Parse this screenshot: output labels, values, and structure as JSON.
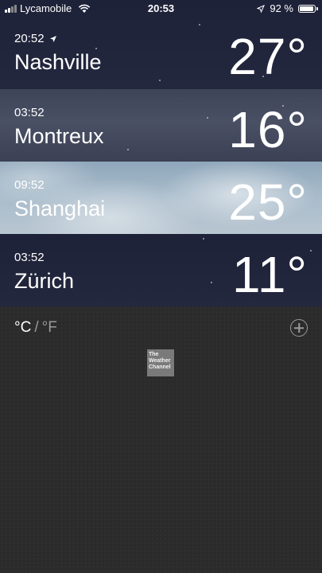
{
  "status_bar": {
    "carrier": "Lycamobile",
    "time": "20:53",
    "battery_percent": "92 %",
    "battery_level": 0.92
  },
  "cities": [
    {
      "local_time": "20:52",
      "name": "Nashville",
      "temperature": "27°",
      "is_current_location": true,
      "background": "night"
    },
    {
      "local_time": "03:52",
      "name": "Montreux",
      "temperature": "16°",
      "is_current_location": false,
      "background": "cloudy-night"
    },
    {
      "local_time": "09:52",
      "name": "Shanghai",
      "temperature": "25°",
      "is_current_location": false,
      "background": "cloudy-day"
    },
    {
      "local_time": "03:52",
      "name": "Zürich",
      "temperature": "11°",
      "is_current_location": false,
      "background": "night"
    }
  ],
  "footer": {
    "unit_celsius": "°C",
    "unit_separator": "/",
    "unit_fahrenheit": "°F",
    "add_icon": "plus-circle-icon",
    "provider_logo_text": "The Weather Channel"
  }
}
